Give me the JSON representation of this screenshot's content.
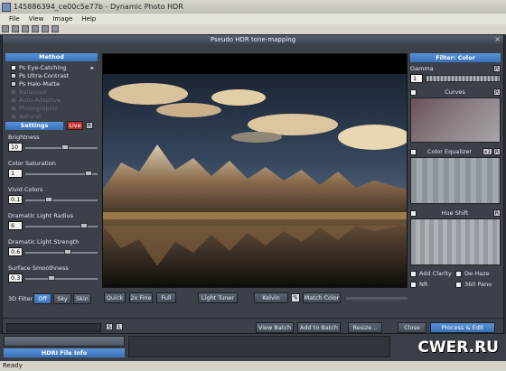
{
  "app": {
    "title": "145886394_ce00c5e77b - Dynamic Photo HDR",
    "menus": [
      "File",
      "View",
      "Image",
      "Help"
    ]
  },
  "dialog": {
    "title": "Pseudo HDR tone-mapping",
    "close": "×"
  },
  "method": {
    "header": "Method",
    "options": [
      "Ps Eye-Catching",
      "Ps Ultra-Contrast",
      "Ps Halo-Matte"
    ],
    "disabled_options": [
      "Balanced",
      "Auto-Adaptive",
      "Photographic",
      "Natural"
    ],
    "selected": "Ps Eye-Catching"
  },
  "settings": {
    "header": "Settings",
    "live_label": "Live",
    "reset_label": "R",
    "brightness": {
      "label": "Brightness",
      "value": "10",
      "level": 0.55
    },
    "color_saturation": {
      "label": "Color Saturation",
      "value": "1",
      "level": 0.92
    },
    "vivid_colors": {
      "label": "Vivid Colors",
      "value": "0.1",
      "level": 0.3
    },
    "dramatic_light_radius": {
      "label": "Dramatic Light Radius",
      "value": "6",
      "level": 0.85
    },
    "dramatic_light_strength": {
      "label": "Dramatic Light Strength",
      "value": "0.6",
      "level": 0.6
    },
    "surface_smoothness": {
      "label": "Surface Smoothness",
      "value": "0.3",
      "level": 0.35
    },
    "filter_3d": {
      "label": "3D Filter",
      "options": [
        "Off",
        "Sky",
        "Skin"
      ],
      "selected": "Off"
    }
  },
  "preview_toolbar": {
    "quick": "Quick",
    "fine": "2x Fine",
    "full": "Full",
    "light_tuner": "Light Tuner",
    "kelvin": "Kelvin",
    "match_color": "Match Color"
  },
  "filters": {
    "header": "Filter: Color",
    "gamma": {
      "label": "Gamma",
      "value": "1",
      "reset": "R"
    },
    "curves": "Curves",
    "color_equalizer": "Color Equalizer",
    "color_equalizer_tag": "x1",
    "hue_shift": "Hue Shift",
    "reset": "R",
    "add_clarity": "Add Clarity",
    "de_haze": "De-Haze",
    "nr": "NR",
    "pano_360": "360 Pano"
  },
  "actions": {
    "view_batch": "View Batch",
    "add_to_batch": "Add to Batch",
    "resize": "Resize...",
    "close": "Close",
    "process_edit": "Process & Edit"
  },
  "bottom": {
    "s_btn": "S",
    "l_btn": "L",
    "file_info": "HDRI File Info",
    "watermark": "CWER.RU"
  },
  "status": {
    "text": "Ready"
  },
  "colors": {
    "accent": "#3870b8",
    "live": "#c0302a",
    "panel": "#3b4049"
  }
}
